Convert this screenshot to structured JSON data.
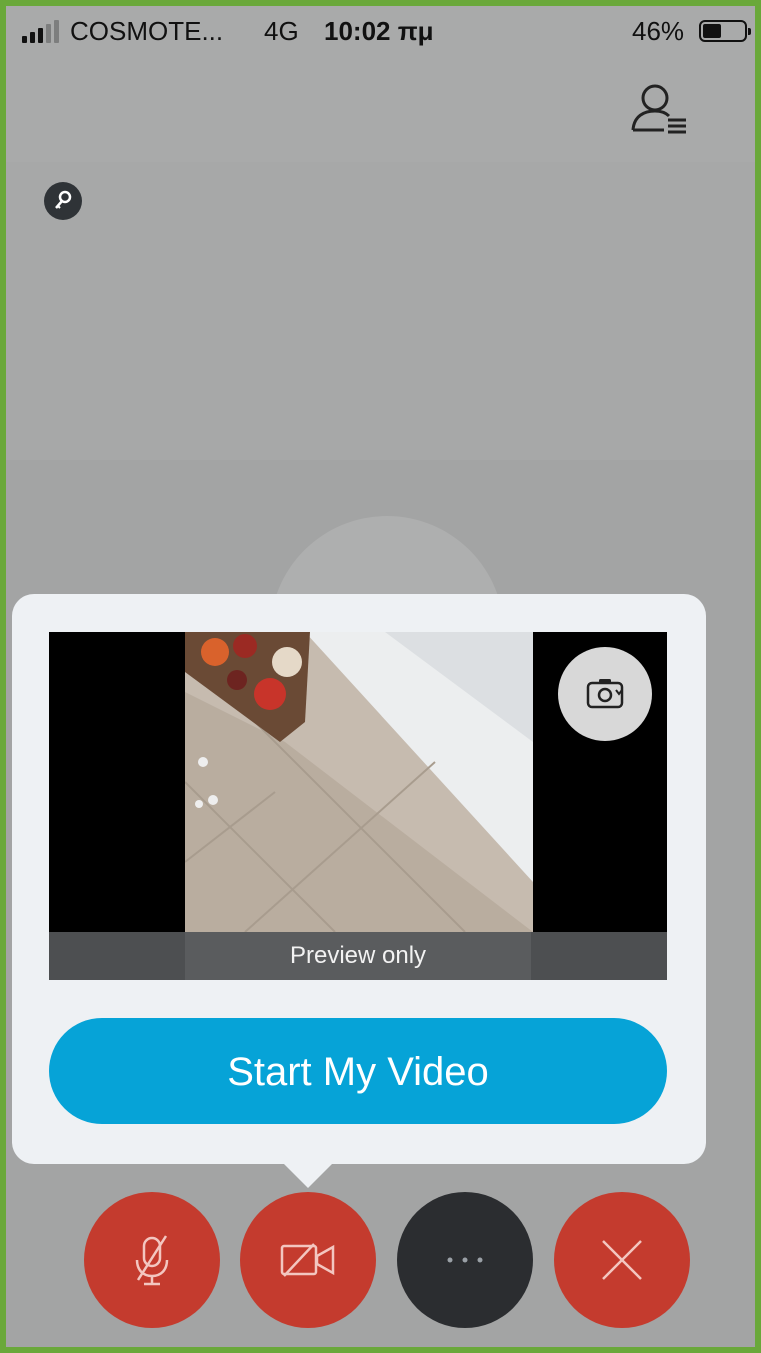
{
  "status_bar": {
    "carrier": "COSMOTE...",
    "network": "4G",
    "time": "10:02 πμ",
    "battery": "46%"
  },
  "header": {
    "participants_icon": "participants-list-icon",
    "lock_icon": "lock-icon"
  },
  "video_preview": {
    "caption": "Preview only",
    "flip_icon": "switch-camera-icon"
  },
  "start_video_button": {
    "label": "Start My Video",
    "color": "#06a3d7"
  },
  "controls": [
    {
      "icon": "microphone-muted-icon",
      "color": "#c43b2e"
    },
    {
      "icon": "video-off-icon",
      "color": "#c43b2e"
    },
    {
      "icon": "more-options-icon",
      "color": "#2b2d30"
    },
    {
      "icon": "close-icon",
      "color": "#c43b2e"
    }
  ],
  "theme": {
    "frame_border": "#6aa83a",
    "popover_bg": "#eef1f4"
  }
}
